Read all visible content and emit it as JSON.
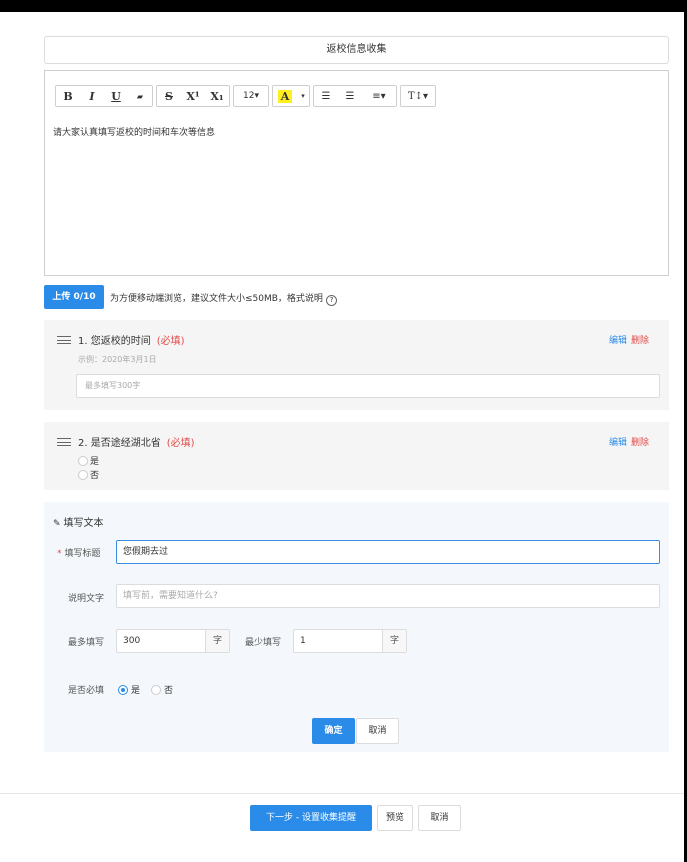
{
  "form": {
    "title": "返校信息收集"
  },
  "editor": {
    "toolbar": {
      "bold": "B",
      "italic": "I",
      "underline": "U",
      "clear": "▰",
      "strike": "S",
      "superscript": "X¹",
      "subscript": "X₁",
      "font_size": "12▾",
      "highlight": "A",
      "highlight_caret": "▾",
      "ul": "☰",
      "ol": "☰",
      "align": "≡▾",
      "text_height": "T↕▾"
    },
    "body": "请大家认真填写返校的时间和车次等信息"
  },
  "upload": {
    "button": "上传 0/10",
    "hint": "为方便移动端浏览，建议文件大小≤50MB，格式说明",
    "help_icon": "?"
  },
  "questions": [
    {
      "title": "1. 您返校的时间",
      "required": "(必填)",
      "example": "示例：2020年3月1日",
      "placeholder": "最多填写300字",
      "edit": "编辑",
      "delete": "删除"
    },
    {
      "title": "2. 是否途经湖北省",
      "required": "(必填)",
      "options": [
        "是",
        "否"
      ],
      "edit": "编辑",
      "delete": "删除"
    }
  ],
  "panel": {
    "title": "填写文本",
    "title_label": "填写标题",
    "title_value": "您假期去过",
    "desc_label": "说明文字",
    "desc_placeholder": "填写前，需要知道什么?",
    "max_label": "最多填写",
    "max_value": "300",
    "min_label": "最少填写",
    "min_value": "1",
    "unit": "字",
    "required_label": "是否必填",
    "required_yes": "是",
    "required_no": "否",
    "ok": "确定",
    "cancel": "取消"
  },
  "footer": {
    "next": "下一步 - 设置收集提醒",
    "preview": "预览",
    "cancel": "取消"
  }
}
